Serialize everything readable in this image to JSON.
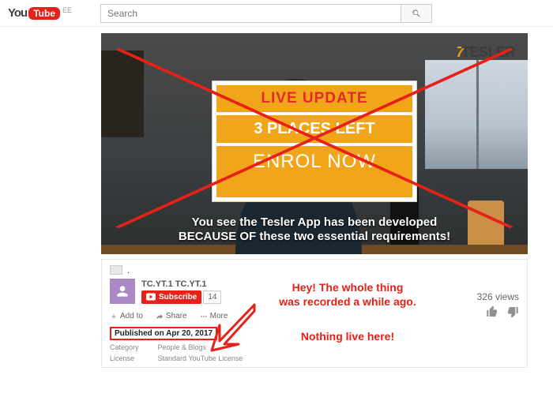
{
  "header": {
    "logo_text1": "You",
    "logo_text2": "Tube",
    "locale": "EE",
    "search_placeholder": "Search"
  },
  "video": {
    "brand_seven": "7",
    "brand_name": "TESLER",
    "card_live": "LIVE UPDATE",
    "card_places": "3 PLACES LEFT",
    "card_enroll": "ENROL NOW",
    "caption_line1": "You see the Tesler App has been developed",
    "caption_line2": "BECAUSE OF these two essential requirements!"
  },
  "info": {
    "title": ".",
    "channel": "TC.YT.1 TC.YT.1",
    "subscribe": "Subscribe",
    "sub_count": "14",
    "views": "326 views",
    "add": "Add to",
    "share": "Share",
    "more": "More",
    "published": "Published on Apr 20, 2017",
    "category_k": "Category",
    "category_v": "People & Blogs",
    "license_k": "License",
    "license_v": "Standard YouTube License"
  },
  "annotations": {
    "line1": "Hey! The whole thing",
    "line2": "was recorded a while ago.",
    "line3": "Nothing live here!"
  }
}
